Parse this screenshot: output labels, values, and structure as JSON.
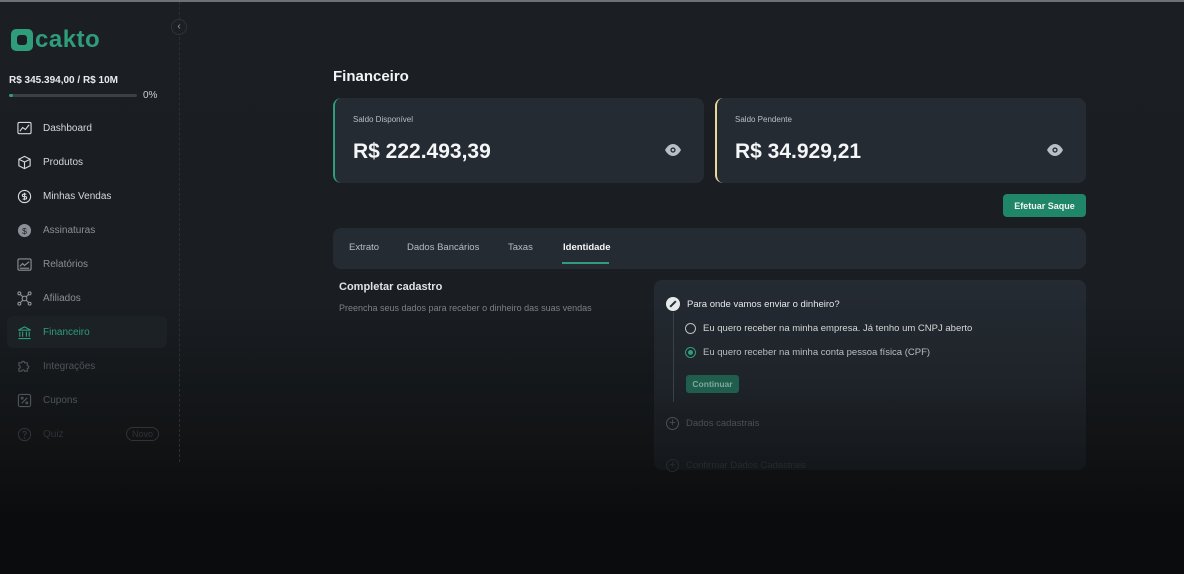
{
  "brand": {
    "name": "cakto",
    "color": "#2f9c7a"
  },
  "sidebar": {
    "revenue": "R$ 345.394,00 / R$ 10M",
    "progress_fraction": 0.0345,
    "progress_label": "0%",
    "items": [
      {
        "label": "Dashboard",
        "icon": "chart-line-icon"
      },
      {
        "label": "Produtos",
        "icon": "box-icon"
      },
      {
        "label": "Minhas Vendas",
        "icon": "dollar-circle-icon"
      },
      {
        "label": "Assinaturas",
        "icon": "coin-icon"
      },
      {
        "label": "Relatórios",
        "icon": "report-icon"
      },
      {
        "label": "Afiliados",
        "icon": "network-icon"
      },
      {
        "label": "Financeiro",
        "icon": "bank-icon",
        "active": true
      },
      {
        "label": "Integrações",
        "icon": "puzzle-icon"
      },
      {
        "label": "Cupons",
        "icon": "percent-icon"
      },
      {
        "label": "Quiz",
        "icon": "question-icon",
        "badge": "Novo"
      }
    ]
  },
  "page": {
    "title": "Financeiro"
  },
  "balances": {
    "available": {
      "label": "Saldo Disponível",
      "value": "R$ 222.493,39",
      "accent": "#2f9c7a"
    },
    "pending": {
      "label": "Saldo Pendente",
      "value": "R$ 34.929,21",
      "accent": "#e7d79b"
    }
  },
  "actions": {
    "withdraw": "Efetuar Saque"
  },
  "tabs": [
    {
      "label": "Extrato"
    },
    {
      "label": "Dados Bancários"
    },
    {
      "label": "Taxas"
    },
    {
      "label": "Identidade",
      "active": true
    }
  ],
  "registration": {
    "title": "Completar cadastro",
    "subtitle": "Preencha seus dados para receber o dinheiro das suas vendas",
    "question": "Para onde vamos enviar o dinheiro?",
    "options": [
      {
        "label": "Eu quero receber na minha empresa. Já tenho um CNPJ aberto",
        "selected": false
      },
      {
        "label": "Eu quero receber na minha conta pessoa física (CPF)",
        "selected": true
      }
    ],
    "continue": "Continuar",
    "step2": "Dados cadastrais",
    "step3": "Confirmar Dados Cadastrais"
  }
}
